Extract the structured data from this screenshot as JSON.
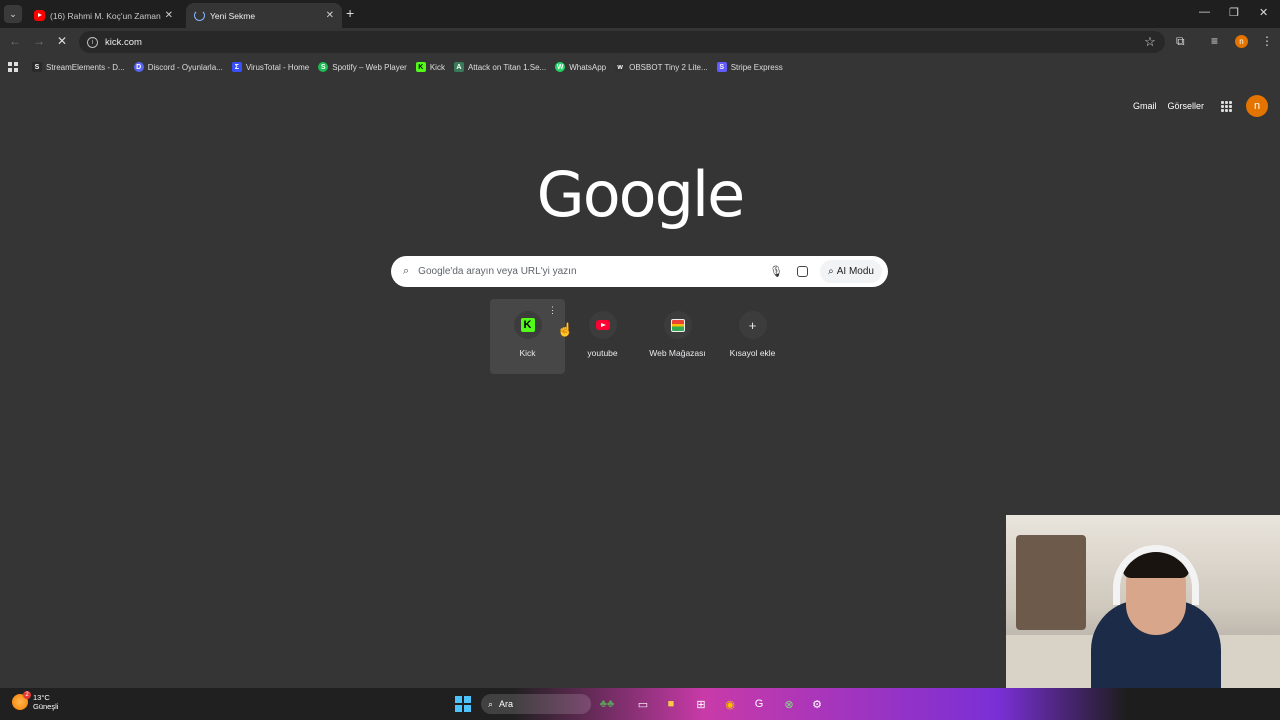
{
  "browser": {
    "tabs": [
      {
        "title": "(16) Rahmi M. Koç'un Zamanı -",
        "active": false
      },
      {
        "title": "Yeni Sekme",
        "active": true
      }
    ],
    "close_glyph": "✕",
    "new_tab_glyph": "+",
    "omnibox_url": "kick.com",
    "window_controls": [
      "—",
      "❐",
      "✕"
    ],
    "profile_initial": "n"
  },
  "bookmarks": [
    {
      "label": "StreamElements - D...",
      "icon": "streamelements-icon",
      "color": "#2a2a2a",
      "glyph": "S"
    },
    {
      "label": "Discord - Oyunlarla...",
      "icon": "discord-icon",
      "color": "#5865f2",
      "glyph": "D"
    },
    {
      "label": "VirusTotal - Home",
      "icon": "virustotal-icon",
      "color": "#394eff",
      "glyph": "Σ"
    },
    {
      "label": "Spotify – Web Player",
      "icon": "spotify-icon",
      "color": "#1db954",
      "glyph": "S"
    },
    {
      "label": "Kick",
      "icon": "kick-icon",
      "color": "#53fc18",
      "glyph": "K"
    },
    {
      "label": "Attack on Titan 1.Se...",
      "icon": "aot-icon",
      "color": "#3a7a5a",
      "glyph": "A"
    },
    {
      "label": "WhatsApp",
      "icon": "whatsapp-icon",
      "color": "#25d366",
      "glyph": "W"
    },
    {
      "label": "OBSBOT Tiny 2 Lite...",
      "icon": "obsbot-icon",
      "color": "#333333",
      "glyph": "w"
    },
    {
      "label": "Stripe Express",
      "icon": "stripe-icon",
      "color": "#635bff",
      "glyph": "S"
    }
  ],
  "google": {
    "header_links": [
      "Gmail",
      "Görseller"
    ],
    "avatar_initial": "n",
    "logo": "Google",
    "search_placeholder": "Google'da arayın veya URL'yi yazın",
    "ai_mode_label": "AI Modu"
  },
  "shortcuts": [
    {
      "label": "Kick",
      "icon": "kick-icon"
    },
    {
      "label": "youtube",
      "icon": "youtube-icon"
    },
    {
      "label": "Web Mağazası",
      "icon": "web-store-icon"
    },
    {
      "label": "Kısayol ekle",
      "icon": "plus-icon"
    }
  ],
  "taskbar": {
    "weather_temp": "13°C",
    "weather_desc": "Güneşli",
    "weather_badge": "2",
    "search_label": "Ara"
  }
}
